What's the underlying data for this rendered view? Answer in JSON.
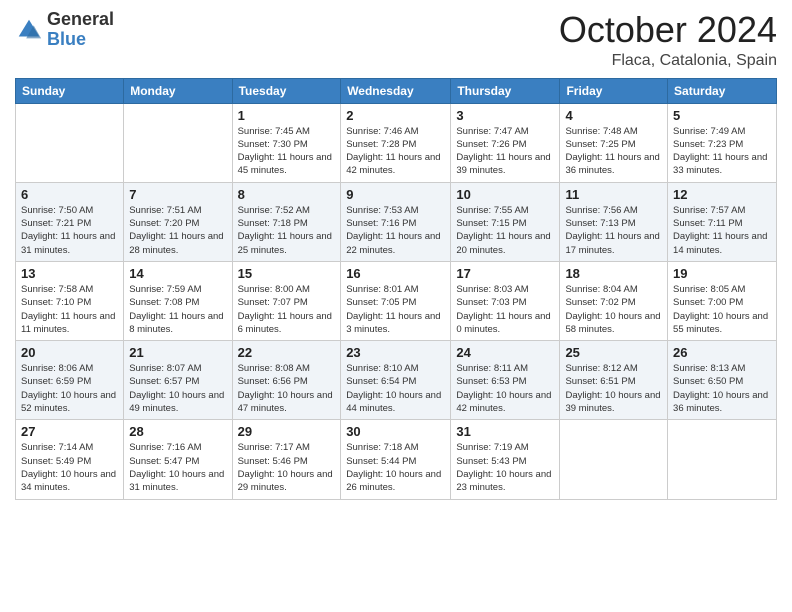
{
  "header": {
    "logo": {
      "line1": "General",
      "line2": "Blue"
    },
    "title": "October 2024",
    "location": "Flaca, Catalonia, Spain"
  },
  "weekdays": [
    "Sunday",
    "Monday",
    "Tuesday",
    "Wednesday",
    "Thursday",
    "Friday",
    "Saturday"
  ],
  "weeks": [
    [
      {
        "day": null
      },
      {
        "day": null
      },
      {
        "day": "1",
        "sunrise": "Sunrise: 7:45 AM",
        "sunset": "Sunset: 7:30 PM",
        "daylight": "Daylight: 11 hours and 45 minutes."
      },
      {
        "day": "2",
        "sunrise": "Sunrise: 7:46 AM",
        "sunset": "Sunset: 7:28 PM",
        "daylight": "Daylight: 11 hours and 42 minutes."
      },
      {
        "day": "3",
        "sunrise": "Sunrise: 7:47 AM",
        "sunset": "Sunset: 7:26 PM",
        "daylight": "Daylight: 11 hours and 39 minutes."
      },
      {
        "day": "4",
        "sunrise": "Sunrise: 7:48 AM",
        "sunset": "Sunset: 7:25 PM",
        "daylight": "Daylight: 11 hours and 36 minutes."
      },
      {
        "day": "5",
        "sunrise": "Sunrise: 7:49 AM",
        "sunset": "Sunset: 7:23 PM",
        "daylight": "Daylight: 11 hours and 33 minutes."
      }
    ],
    [
      {
        "day": "6",
        "sunrise": "Sunrise: 7:50 AM",
        "sunset": "Sunset: 7:21 PM",
        "daylight": "Daylight: 11 hours and 31 minutes."
      },
      {
        "day": "7",
        "sunrise": "Sunrise: 7:51 AM",
        "sunset": "Sunset: 7:20 PM",
        "daylight": "Daylight: 11 hours and 28 minutes."
      },
      {
        "day": "8",
        "sunrise": "Sunrise: 7:52 AM",
        "sunset": "Sunset: 7:18 PM",
        "daylight": "Daylight: 11 hours and 25 minutes."
      },
      {
        "day": "9",
        "sunrise": "Sunrise: 7:53 AM",
        "sunset": "Sunset: 7:16 PM",
        "daylight": "Daylight: 11 hours and 22 minutes."
      },
      {
        "day": "10",
        "sunrise": "Sunrise: 7:55 AM",
        "sunset": "Sunset: 7:15 PM",
        "daylight": "Daylight: 11 hours and 20 minutes."
      },
      {
        "day": "11",
        "sunrise": "Sunrise: 7:56 AM",
        "sunset": "Sunset: 7:13 PM",
        "daylight": "Daylight: 11 hours and 17 minutes."
      },
      {
        "day": "12",
        "sunrise": "Sunrise: 7:57 AM",
        "sunset": "Sunset: 7:11 PM",
        "daylight": "Daylight: 11 hours and 14 minutes."
      }
    ],
    [
      {
        "day": "13",
        "sunrise": "Sunrise: 7:58 AM",
        "sunset": "Sunset: 7:10 PM",
        "daylight": "Daylight: 11 hours and 11 minutes."
      },
      {
        "day": "14",
        "sunrise": "Sunrise: 7:59 AM",
        "sunset": "Sunset: 7:08 PM",
        "daylight": "Daylight: 11 hours and 8 minutes."
      },
      {
        "day": "15",
        "sunrise": "Sunrise: 8:00 AM",
        "sunset": "Sunset: 7:07 PM",
        "daylight": "Daylight: 11 hours and 6 minutes."
      },
      {
        "day": "16",
        "sunrise": "Sunrise: 8:01 AM",
        "sunset": "Sunset: 7:05 PM",
        "daylight": "Daylight: 11 hours and 3 minutes."
      },
      {
        "day": "17",
        "sunrise": "Sunrise: 8:03 AM",
        "sunset": "Sunset: 7:03 PM",
        "daylight": "Daylight: 11 hours and 0 minutes."
      },
      {
        "day": "18",
        "sunrise": "Sunrise: 8:04 AM",
        "sunset": "Sunset: 7:02 PM",
        "daylight": "Daylight: 10 hours and 58 minutes."
      },
      {
        "day": "19",
        "sunrise": "Sunrise: 8:05 AM",
        "sunset": "Sunset: 7:00 PM",
        "daylight": "Daylight: 10 hours and 55 minutes."
      }
    ],
    [
      {
        "day": "20",
        "sunrise": "Sunrise: 8:06 AM",
        "sunset": "Sunset: 6:59 PM",
        "daylight": "Daylight: 10 hours and 52 minutes."
      },
      {
        "day": "21",
        "sunrise": "Sunrise: 8:07 AM",
        "sunset": "Sunset: 6:57 PM",
        "daylight": "Daylight: 10 hours and 49 minutes."
      },
      {
        "day": "22",
        "sunrise": "Sunrise: 8:08 AM",
        "sunset": "Sunset: 6:56 PM",
        "daylight": "Daylight: 10 hours and 47 minutes."
      },
      {
        "day": "23",
        "sunrise": "Sunrise: 8:10 AM",
        "sunset": "Sunset: 6:54 PM",
        "daylight": "Daylight: 10 hours and 44 minutes."
      },
      {
        "day": "24",
        "sunrise": "Sunrise: 8:11 AM",
        "sunset": "Sunset: 6:53 PM",
        "daylight": "Daylight: 10 hours and 42 minutes."
      },
      {
        "day": "25",
        "sunrise": "Sunrise: 8:12 AM",
        "sunset": "Sunset: 6:51 PM",
        "daylight": "Daylight: 10 hours and 39 minutes."
      },
      {
        "day": "26",
        "sunrise": "Sunrise: 8:13 AM",
        "sunset": "Sunset: 6:50 PM",
        "daylight": "Daylight: 10 hours and 36 minutes."
      }
    ],
    [
      {
        "day": "27",
        "sunrise": "Sunrise: 7:14 AM",
        "sunset": "Sunset: 5:49 PM",
        "daylight": "Daylight: 10 hours and 34 minutes."
      },
      {
        "day": "28",
        "sunrise": "Sunrise: 7:16 AM",
        "sunset": "Sunset: 5:47 PM",
        "daylight": "Daylight: 10 hours and 31 minutes."
      },
      {
        "day": "29",
        "sunrise": "Sunrise: 7:17 AM",
        "sunset": "Sunset: 5:46 PM",
        "daylight": "Daylight: 10 hours and 29 minutes."
      },
      {
        "day": "30",
        "sunrise": "Sunrise: 7:18 AM",
        "sunset": "Sunset: 5:44 PM",
        "daylight": "Daylight: 10 hours and 26 minutes."
      },
      {
        "day": "31",
        "sunrise": "Sunrise: 7:19 AM",
        "sunset": "Sunset: 5:43 PM",
        "daylight": "Daylight: 10 hours and 23 minutes."
      },
      {
        "day": null
      },
      {
        "day": null
      }
    ]
  ]
}
